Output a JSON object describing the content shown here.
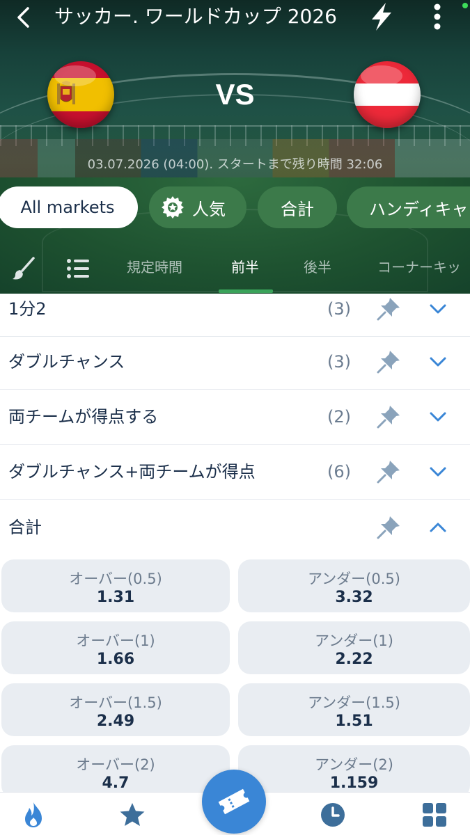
{
  "header": {
    "title": "サッカー. ワールドカップ 2026",
    "vs": "VS",
    "match_time": "03.07.2026 (04:00). スタートまで残り時間 32:06"
  },
  "teams": {
    "home_flag": "spain-flag",
    "away_flag": "austria-flag"
  },
  "chips": [
    {
      "label": "All markets",
      "active": true
    },
    {
      "label": "人気",
      "icon": "gear-icon"
    },
    {
      "label": "合計"
    },
    {
      "label": "ハンディキャ"
    }
  ],
  "tabs": [
    {
      "label": "規定時間"
    },
    {
      "label": "前半",
      "active": true
    },
    {
      "label": "後半"
    },
    {
      "label": "コーナーキッ"
    }
  ],
  "markets": [
    {
      "label": "1分2",
      "count": "(3)",
      "expanded": false
    },
    {
      "label": "ダブルチャンス",
      "count": "(3)",
      "expanded": false
    },
    {
      "label": "両チームが得点する",
      "count": "(2)",
      "expanded": false
    },
    {
      "label": "ダブルチャンス+両チームが得点",
      "count": "(6)",
      "expanded": false
    },
    {
      "label": "合計",
      "count": "",
      "expanded": true
    }
  ],
  "totals": [
    {
      "over_label": "オーバー(0.5)",
      "over_value": "1.31",
      "under_label": "アンダー(0.5)",
      "under_value": "3.32"
    },
    {
      "over_label": "オーバー(1)",
      "over_value": "1.66",
      "under_label": "アンダー(1)",
      "under_value": "2.22"
    },
    {
      "over_label": "オーバー(1.5)",
      "over_value": "2.49",
      "under_label": "アンダー(1.5)",
      "under_value": "1.51"
    },
    {
      "over_label": "オーバー(2)",
      "over_value": "4.7",
      "under_label": "アンダー(2)",
      "under_value": "1.159"
    }
  ],
  "bottom_nav": [
    "fire-icon",
    "star-icon",
    "ticket-icon",
    "clock-icon",
    "grid-icon"
  ],
  "colors": {
    "accent_blue": "#3a86d6",
    "chip_green": "#3c7a4a",
    "tab_underline": "#3aa35a",
    "text_dark": "#1b2f4a"
  }
}
